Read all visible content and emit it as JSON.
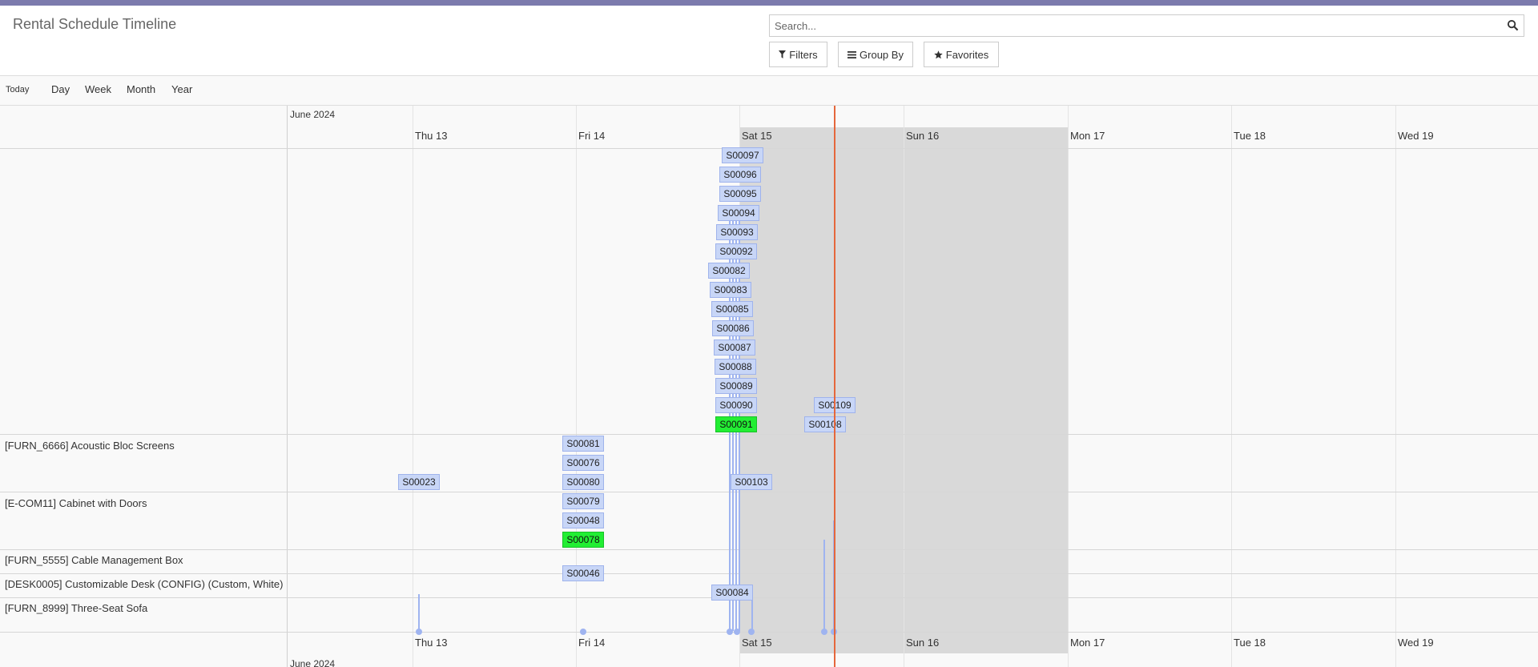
{
  "title": "Rental Schedule Timeline",
  "search": {
    "placeholder": "Search..."
  },
  "filters": {
    "filters_label": "Filters",
    "groupby_label": "Group By",
    "favorites_label": "Favorites"
  },
  "scales": {
    "today": "Today",
    "day": "Day",
    "week": "Week",
    "month": "Month",
    "year": "Year"
  },
  "timeline": {
    "month_label": "June 2024",
    "days": [
      "Thu 13",
      "Fri 14",
      "Sat 15",
      "Sun 16",
      "Mon 17",
      "Tue 18",
      "Wed 19"
    ],
    "groups": [
      "[FURN_6666] Acoustic Bloc Screens",
      "[E-COM11] Cabinet with Doors",
      "[FURN_5555] Cable Management Box",
      "[DESK0005] Customizable Desk (CONFIG) (Custom, White)",
      "[FURN_8999] Three-Seat Sofa"
    ],
    "items": [
      {
        "label": "S00097",
        "selected": false
      },
      {
        "label": "S00096",
        "selected": false
      },
      {
        "label": "S00095",
        "selected": false
      },
      {
        "label": "S00094",
        "selected": false
      },
      {
        "label": "S00093",
        "selected": false
      },
      {
        "label": "S00092",
        "selected": false
      },
      {
        "label": "S00082",
        "selected": false
      },
      {
        "label": "S00083",
        "selected": false
      },
      {
        "label": "S00085",
        "selected": false
      },
      {
        "label": "S00086",
        "selected": false
      },
      {
        "label": "S00087",
        "selected": false
      },
      {
        "label": "S00088",
        "selected": false
      },
      {
        "label": "S00089",
        "selected": false
      },
      {
        "label": "S00090",
        "selected": false
      },
      {
        "label": "S00109",
        "selected": false
      },
      {
        "label": "S00091",
        "selected": true
      },
      {
        "label": "S00108",
        "selected": false
      },
      {
        "label": "S00081",
        "selected": false
      },
      {
        "label": "S00076",
        "selected": false
      },
      {
        "label": "S00023",
        "selected": false
      },
      {
        "label": "S00080",
        "selected": false
      },
      {
        "label": "S00103",
        "selected": false
      },
      {
        "label": "S00079",
        "selected": false
      },
      {
        "label": "S00048",
        "selected": false
      },
      {
        "label": "S00078",
        "selected": true
      },
      {
        "label": "S00046",
        "selected": false
      },
      {
        "label": "S00084",
        "selected": false
      }
    ]
  },
  "colors": {
    "accent": "#7c7bad",
    "item": "#c8d6f7",
    "selected_item": "#22ee33",
    "now_marker": "#e5673c",
    "weekend": "#d9d9d9"
  }
}
